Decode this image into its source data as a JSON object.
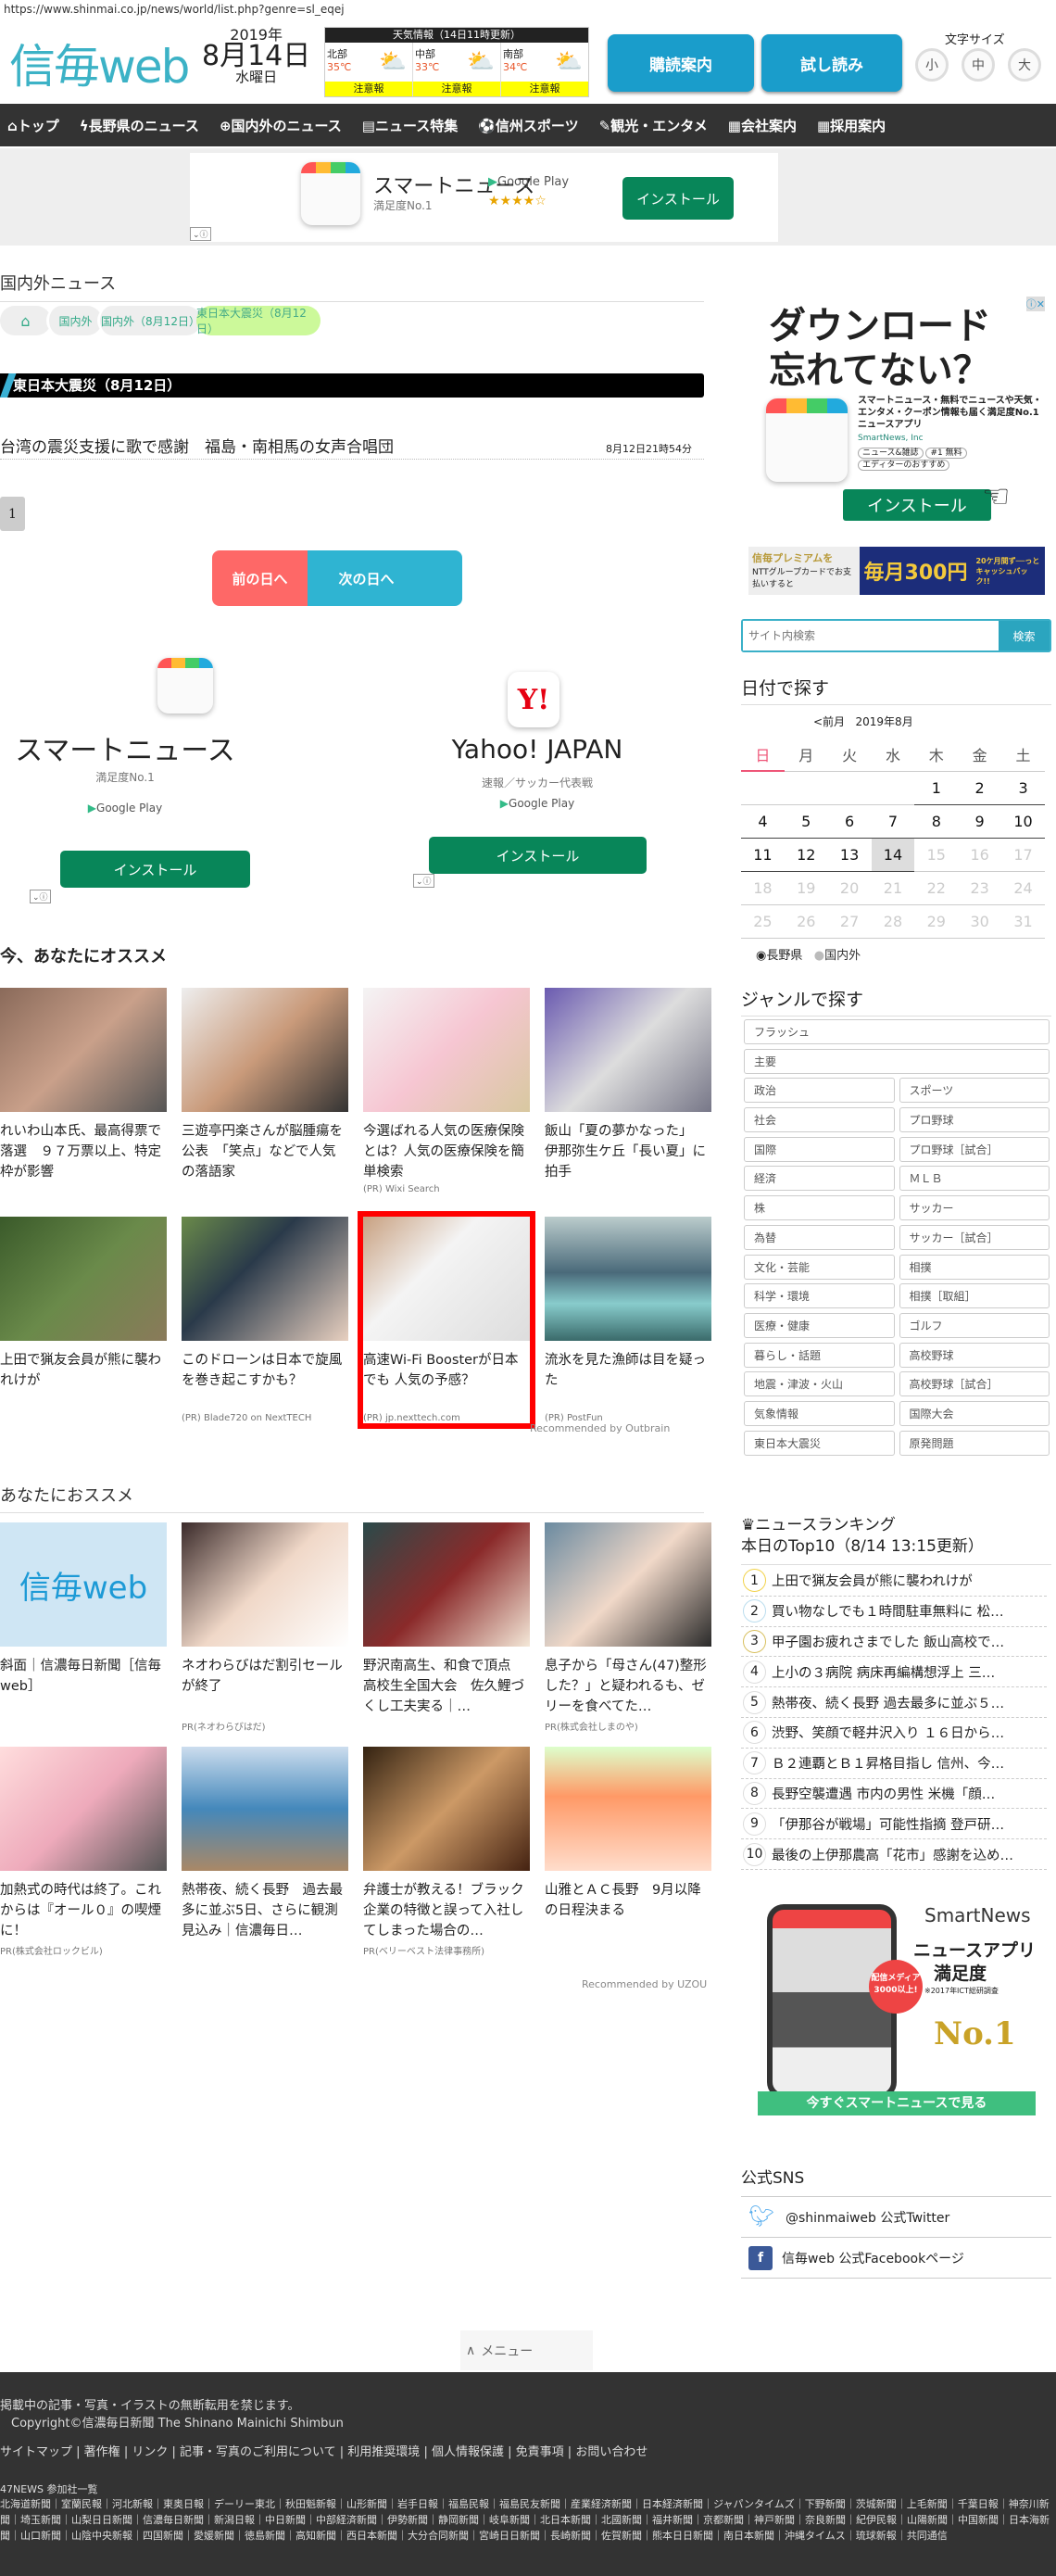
{
  "url": "https://www.shinmai.co.jp/news/world/list.php?genre=sl_eqej",
  "header": {
    "logo": "信毎web",
    "year": "2019年",
    "date": "8月14日",
    "weekday": "水曜日",
    "weather": {
      "title": "天気情報（14日11時更新）",
      "areas": [
        {
          "name": "北部",
          "temp": "35℃",
          "warning": "注意報"
        },
        {
          "name": "中部",
          "temp": "33℃",
          "warning": "注意報"
        },
        {
          "name": "南部",
          "temp": "34℃",
          "warning": "注意報"
        }
      ]
    },
    "subscribe": "購読案内",
    "trial": "試し読み",
    "font_size_label": "文字サイズ",
    "font_sizes": [
      "小",
      "中",
      "大"
    ]
  },
  "nav": [
    "トップ",
    "長野県のニュース",
    "国内外のニュース",
    "ニュース特集",
    "信州スポーツ",
    "観光・エンタメ",
    "会社案内",
    "採用案内"
  ],
  "top_ad": {
    "app": "スマートニュース",
    "sub": "満足度No.1",
    "store": "Google Play",
    "stars": "★★★★☆",
    "install": "インストール"
  },
  "main": {
    "section_title": "国内外ニュース",
    "breadcrumb": [
      "国内外",
      "国内外（8月12日）",
      "東日本大震災（8月12日）"
    ],
    "category_title": "東日本大震災（8月12日）",
    "articles": [
      {
        "title": "台湾の震災支援に歌で感謝　福島・南相馬の女声合唱団",
        "time": "8月12日21時54分"
      }
    ],
    "page": "1",
    "prev_day": "前の日へ",
    "next_day": "次の日へ",
    "app_ads": [
      {
        "name": "スマートニュース",
        "sub": "満足度No.1",
        "store": "Google Play",
        "install": "インストール"
      },
      {
        "name": "Yahoo! JAPAN",
        "sub": "速報／サッカー代表戦",
        "store": "Google Play",
        "install": "インストール"
      }
    ],
    "recommend1_title": "今、あなたにオススメ",
    "recommend1": [
      {
        "title": "れいわ山本氏、最高得票で落選　９７万票以上、特定枠が影響",
        "pr": ""
      },
      {
        "title": "三遊亭円楽さんが脳腫瘍を公表　「笑点」などで人気の落語家",
        "pr": ""
      },
      {
        "title": "今選ばれる人気の医療保険とは？人気の医療保険を簡単検索",
        "pr": "(PR) Wixi Search"
      },
      {
        "title": "飯山「夏の夢かなった」　伊那弥生ケ丘「長い夏」に拍手",
        "pr": ""
      },
      {
        "title": "上田で猟友会員が熊に襲われけが",
        "pr": ""
      },
      {
        "title": "このドローンは日本で旋風を巻き起こすかも？",
        "pr": "(PR) Blade720 on NextTECH"
      },
      {
        "title": "高速Wi-Fi Boosterが日本でも 人気の予感？",
        "pr": "(PR) jp.nexttech.com"
      },
      {
        "title": "流氷を見た漁師は目を疑った",
        "pr": "(PR) PostFun"
      }
    ],
    "outbrain": "Recommended by Outbrain",
    "recommend2_title": "あなたにおススメ",
    "recommend2": [
      {
        "title": "斜面｜信濃毎日新聞［信毎web］",
        "pr": ""
      },
      {
        "title": "ネオわらびはだ割引セールが終了",
        "pr": "PR(ネオわらびはだ)"
      },
      {
        "title": "野沢南高生、和食で頂点　高校生全国大会　佐久鯉づくし工夫実る｜…",
        "pr": ""
      },
      {
        "title": "息子から「母さん(47)整形した？」と疑われるも、ゼリーを食べてた…",
        "pr": "PR(株式会社しまのや)"
      },
      {
        "title": "加熱式の時代は終了。これからは『オール０』の喫煙に！",
        "pr": "PR(株式会社ロックビル)"
      },
      {
        "title": "熱帯夜、続く長野　過去最多に並ぶ5日、さらに観測見込み｜信濃毎日…",
        "pr": ""
      },
      {
        "title": "弁護士が教える！ブラック企業の特徴と誤って入社してしまった場合の…",
        "pr": "PR(ベリーベスト法律事務所)"
      },
      {
        "title": "山雅とＡＣ長野　9月以降の日程決まる",
        "pr": ""
      }
    ],
    "uzou": "Recommended by UZOU",
    "menu": "メニュー"
  },
  "sidebar": {
    "ad1": {
      "headline1": "ダウンロード",
      "headline2": "忘れてない？",
      "desc": "スマートニュース・無料でニュースや天気・エンタメ・クーポン情報も届く満足度No.1ニュースアプリ",
      "company": "SmartNews, Inc",
      "tags": [
        "ニュース&雑誌",
        "#1 無料",
        "エディターのおすすめ"
      ],
      "install": "インストール"
    },
    "premium": {
      "left": "信毎プレミアムを",
      "card": "NTTグループカードでお支払いすると",
      "right": "毎月300円",
      "cashback": "20ケ月間ず──っと キャッシュバック!!"
    },
    "search_placeholder": "サイト内検索",
    "search_button": "検索",
    "calendar": {
      "title": "日付で探す",
      "prev": "<前月",
      "month": "2019年8月",
      "weekdays": [
        "日",
        "月",
        "火",
        "水",
        "木",
        "金",
        "土"
      ],
      "weeks": [
        [
          "",
          "",
          "",
          "",
          "1",
          "2",
          "3"
        ],
        [
          "4",
          "5",
          "6",
          "7",
          "8",
          "9",
          "10"
        ],
        [
          "11",
          "12",
          "13",
          "14",
          "15",
          "16",
          "17"
        ],
        [
          "18",
          "19",
          "20",
          "21",
          "22",
          "23",
          "24"
        ],
        [
          "25",
          "26",
          "27",
          "28",
          "29",
          "30",
          "31"
        ]
      ],
      "today": "14",
      "radios": [
        "長野県",
        "国内外"
      ]
    },
    "genre_title": "ジャンルで探す",
    "genres_full": [
      "フラッシュ",
      "主要"
    ],
    "genres": [
      [
        "政治",
        "スポーツ"
      ],
      [
        "社会",
        "プロ野球"
      ],
      [
        "国際",
        "プロ野球［試合］"
      ],
      [
        "経済",
        "ＭＬＢ"
      ],
      [
        "株",
        "サッカー"
      ],
      [
        "為替",
        "サッカー［試合］"
      ],
      [
        "文化・芸能",
        "相撲"
      ],
      [
        "科学・環境",
        "相撲［取組］"
      ],
      [
        "医療・健康",
        "ゴルフ"
      ],
      [
        "暮らし・話題",
        "高校野球"
      ],
      [
        "地震・津波・火山",
        "高校野球［試合］"
      ],
      [
        "気象情報",
        "国際大会"
      ],
      [
        "東日本大震災",
        "原発問題"
      ]
    ],
    "ranking_title": "ニュースランキング",
    "ranking_sub": "本日のTop10（8/14 13:15更新）",
    "ranking": [
      "上田で猟友会員が熊に襲われけが",
      "買い物なしでも１時間駐車無料に 松…",
      "甲子園お疲れさまでした 飯山高校で…",
      "上小の３病院 病床再編構想浮上 三…",
      "熱帯夜、続く長野 過去最多に並ぶ５…",
      "渋野、笑顔で軽井沢入り １６日から…",
      "Ｂ２連覇とＢ１昇格目指し 信州、今…",
      "長野空襲遭遇 市内の男性 米機「顔…",
      "「伊那谷が戦場」可能性指摘 登戸研…",
      "最後の上伊那農高「花市」感謝を込め…"
    ],
    "ad2": {
      "brand": "SmartNews",
      "h1": "ニュースアプリ",
      "h2": "満足度",
      "note": "※2017年ICT総研調査",
      "badge": "配信メディア3000以上!",
      "award": "No.1",
      "cta": "今すぐスマートニュースで見る"
    },
    "sns_title": "公式SNS",
    "sns": [
      "@shinmaiweb 公式Twitter",
      "信毎web 公式Facebookページ"
    ]
  },
  "footer": {
    "notice": "掲載中の記事・写真・イラストの無断転用を禁じます。",
    "copyright": "Copyright©信濃毎日新聞 The Shinano Mainichi Shimbun",
    "links": [
      "サイトマップ",
      "著作権",
      "リンク",
      "記事・写真のご利用について",
      "利用推奨環境",
      "個人情報保護",
      "免責事項",
      "お問い合わせ"
    ],
    "members_title": "47NEWS 参加社一覧",
    "members": "北海道新聞｜室蘭民報｜河北新報｜東奥日報｜デーリー東北｜秋田魁新報｜山形新聞｜岩手日報｜福島民報｜福島民友新聞｜産業経済新聞｜日本経済新聞｜ジャパンタイムズ｜下野新聞｜茨城新聞｜上毛新聞｜千葉日報｜神奈川新聞｜埼玉新聞｜山梨日日新聞｜信濃毎日新聞｜新潟日報｜中日新聞｜中部経済新聞｜伊勢新聞｜静岡新聞｜岐阜新聞｜北日本新聞｜北國新聞｜福井新聞｜京都新聞｜神戸新聞｜奈良新聞｜紀伊民報｜山陽新聞｜中国新聞｜日本海新聞｜山口新聞｜山陰中央新報｜四国新聞｜愛媛新聞｜徳島新聞｜高知新聞｜西日本新聞｜大分合同新聞｜宮崎日日新聞｜長崎新聞｜佐賀新聞｜熊本日日新聞｜南日本新聞｜沖縄タイムス｜琉球新報｜共同通信"
  },
  "colors": {
    "brand": "#3cb2c6",
    "button": "#1a9dcb",
    "prev": "#fe6867",
    "next": "#2fb4d2",
    "install": "#088659",
    "nav": "#333333"
  }
}
